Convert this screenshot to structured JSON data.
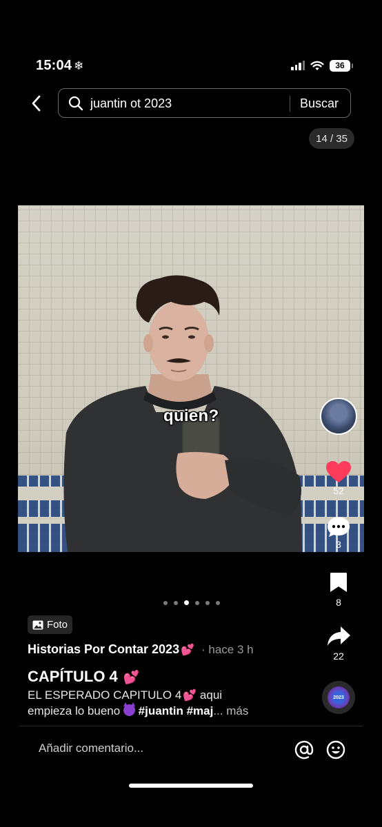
{
  "status_bar": {
    "time": "15:04",
    "time_icon": "snowflake-icon",
    "battery": "36"
  },
  "search": {
    "query": "juantin ot 2023",
    "button": "Buscar"
  },
  "counter": "14 / 35",
  "photo": {
    "sticker_text": "quien?"
  },
  "actions": {
    "likes": "52",
    "comments": "3",
    "saves": "8",
    "shares": "22"
  },
  "carousel": {
    "total": 6,
    "active_index": 2
  },
  "post": {
    "badge": "Foto",
    "author": "Historias Por Contar 2023",
    "author_emoji": "💕",
    "time": "· hace 3 h",
    "title": "CAPÍTULO 4",
    "title_emoji": "💕",
    "desc_1": "EL ESPERADO CAPITULO 4",
    "desc_emoji": "💕",
    "desc_2": " aqui",
    "desc_3": "empieza lo bueno ",
    "hashtag_1": "#juantin",
    "hashtag_2": "#maj",
    "ellipsis": "...",
    "more": "más"
  },
  "music_disc": {
    "text": "2023"
  },
  "comment": {
    "placeholder": "Añadir comentario..."
  },
  "colors": {
    "background": "#000000",
    "like_red": "#ff3b5c",
    "pink_emoji": "#ff4fa3"
  }
}
